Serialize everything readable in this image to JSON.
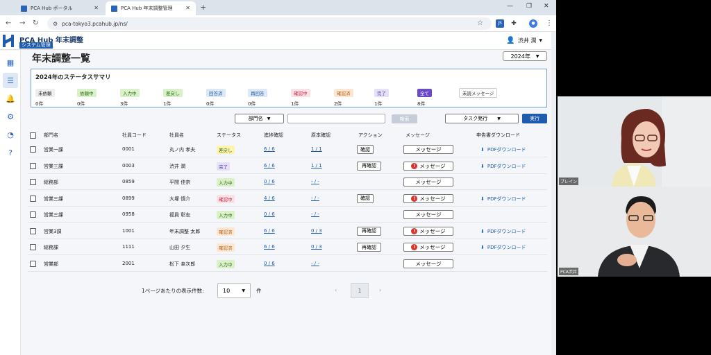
{
  "browser": {
    "tabs": [
      {
        "label": "PCA Hub ポータル",
        "active": false
      },
      {
        "label": "PCA Hub 年末調整管理",
        "active": true
      }
    ],
    "url": "pca-tokyo3.pcahub.jp/ns/"
  },
  "app": {
    "logo_text": "PCA Hub 年末調整",
    "logo_badge": "システム管理",
    "user_name": "渋井 潤",
    "page_title": "年末調整一覧",
    "year": "2024年",
    "brand_color": "#1f5cae"
  },
  "summary": {
    "title": "2024年のステータスサマリ",
    "items": [
      {
        "label": "未依頼",
        "count": "0件",
        "bg": "#eeeeee",
        "fg": "#222222"
      },
      {
        "label": "依頼中",
        "count": "0件",
        "bg": "#d9f0c8",
        "fg": "#2f6b1a"
      },
      {
        "label": "入力中",
        "count": "3件",
        "bg": "#d9f0c8",
        "fg": "#2f6b1a"
      },
      {
        "label": "差戻し",
        "count": "1件",
        "bg": "#d9f0c8",
        "fg": "#2f6b1a"
      },
      {
        "label": "回答済",
        "count": "0件",
        "bg": "#dce8f7",
        "fg": "#2a5a9b"
      },
      {
        "label": "再回答",
        "count": "0件",
        "bg": "#dce8f7",
        "fg": "#2a5a9b"
      },
      {
        "label": "確認中",
        "count": "1件",
        "bg": "#fbe0e6",
        "fg": "#c0284a"
      },
      {
        "label": "確認済",
        "count": "2件",
        "bg": "#fde7d2",
        "fg": "#b0601c"
      },
      {
        "label": "完了",
        "count": "1件",
        "bg": "#e6e0f6",
        "fg": "#5a3fb0"
      },
      {
        "label": "全て",
        "count": "8件",
        "bg": "#6a4bc4",
        "fg": "#ffffff"
      },
      {
        "label": "未読メッセージ",
        "count": "",
        "bg": "#ffffff",
        "fg": "#222222"
      }
    ]
  },
  "filters": {
    "department": "部門名",
    "search_button": "検索",
    "task_select": "タスク発行",
    "run_button": "実行"
  },
  "table": {
    "headers": [
      "部門名",
      "社員コード",
      "社員名",
      "ステータス",
      "進捗確認",
      "原本確認",
      "アクション",
      "メッセージ",
      "申告書ダウンロード"
    ],
    "rows": [
      {
        "dept": "営業一課",
        "code": "0001",
        "name": "丸ノ内 孝夫",
        "status": "差戻し",
        "status_bg": "#fff3b0",
        "status_fg": "#3a6b1a",
        "progress": "6 / 6",
        "original": "1 / 1",
        "action": "確認",
        "message": "メッセージ",
        "alert": false,
        "pdf": "PDFダウンロード"
      },
      {
        "dept": "営業三課",
        "code": "0003",
        "name": "渋井 潤",
        "status": "完了",
        "status_bg": "#e6e0f6",
        "status_fg": "#5a3fb0",
        "progress": "6 / 6",
        "original": "1 / 1",
        "action": "再確認",
        "message": "メッセージ",
        "alert": true,
        "pdf": "PDFダウンロード"
      },
      {
        "dept": "総務部",
        "code": "0859",
        "name": "平間 佳奈",
        "status": "入力中",
        "status_bg": "#d9f0c8",
        "status_fg": "#2f6b1a",
        "progress": "0 / 6",
        "original": "- / -",
        "action": "",
        "message": "メッセージ",
        "alert": false,
        "pdf": ""
      },
      {
        "dept": "営業三課",
        "code": "0899",
        "name": "大塚 慎介",
        "status": "確認中",
        "status_bg": "#fbe0e6",
        "status_fg": "#c0284a",
        "progress": "4 / 6",
        "original": "- / -",
        "action": "確認",
        "message": "メッセージ",
        "alert": true,
        "pdf": "PDFダウンロード"
      },
      {
        "dept": "営業三課",
        "code": "0958",
        "name": "福員 彰志",
        "status": "入力中",
        "status_bg": "#d9f0c8",
        "status_fg": "#2f6b1a",
        "progress": "0 / 6",
        "original": "- / -",
        "action": "",
        "message": "メッセージ",
        "alert": false,
        "pdf": ""
      },
      {
        "dept": "営業3課",
        "code": "1001",
        "name": "年末調整 太郎",
        "status": "確認済",
        "status_bg": "#fde7d2",
        "status_fg": "#b0601c",
        "progress": "6 / 6",
        "original": "0 / 3",
        "action": "再確認",
        "message": "メッセージ",
        "alert": true,
        "pdf": "PDFダウンロード"
      },
      {
        "dept": "総務課",
        "code": "1111",
        "name": "山田 夕生",
        "status": "確認済",
        "status_bg": "#fde7d2",
        "status_fg": "#b0601c",
        "progress": "6 / 6",
        "original": "0 / 3",
        "action": "再確認",
        "message": "メッセージ",
        "alert": true,
        "pdf": "PDFダウンロード"
      },
      {
        "dept": "営業部",
        "code": "2001",
        "name": "松下 幸次郎",
        "status": "入力中",
        "status_bg": "#d9f0c8",
        "status_fg": "#2f6b1a",
        "progress": "0 / 6",
        "original": "- / -",
        "action": "",
        "message": "メッセージ",
        "alert": false,
        "pdf": ""
      }
    ]
  },
  "pager": {
    "label": "1ページあたりの表示件数:",
    "per_page": "10",
    "unit": "件",
    "current_page": "1"
  },
  "video": {
    "tiles": [
      {
        "name": "ブレイン"
      },
      {
        "name": "PCA渋井"
      }
    ]
  }
}
